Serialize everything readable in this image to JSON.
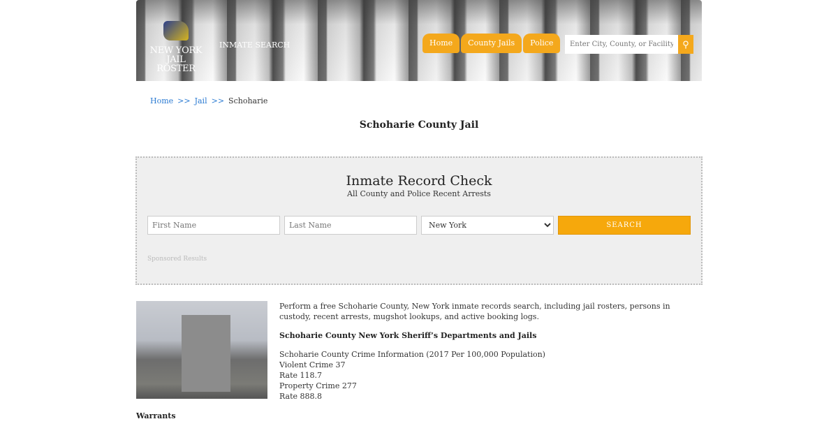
{
  "header": {
    "logo_line1": "NEW YORK",
    "logo_line2": "JAIL ROSTER",
    "inmate_search": "INMATE SEARCH",
    "nav": [
      "Home",
      "County Jails",
      "Police"
    ],
    "search_placeholder": "Enter City, County, or Facility",
    "accent": "#f4a81c"
  },
  "breadcrumb": {
    "items": [
      "Home",
      "Jail",
      "Schoharie"
    ],
    "separator": ">>"
  },
  "page_title": "Schoharie County Jail",
  "record_check": {
    "title": "Inmate Record Check",
    "subtitle": "All County and Police Recent Arrests",
    "first_name_placeholder": "First Name",
    "last_name_placeholder": "Last Name",
    "state": "New York",
    "search_label": "SEARCH",
    "sponsored": "Sponsored Results"
  },
  "content": {
    "intro": "Perform a free Schoharie County, New York inmate records search, including jail rosters, persons in custody, recent arrests, mugshot lookups, and active booking logs.",
    "heading": "Schoharie County New York Sheriff’s Departments and Jails",
    "crime_lines": [
      "Schoharie County Crime Information (2017 Per 100,000 Population)",
      "Violent Crime 37",
      "Rate 118.7",
      "Property Crime 277",
      "Rate 888.8"
    ],
    "warrants": "Warrants"
  }
}
